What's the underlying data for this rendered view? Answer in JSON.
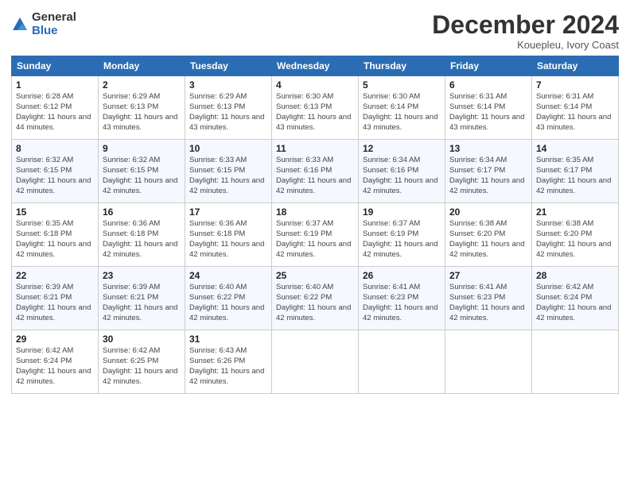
{
  "logo": {
    "general": "General",
    "blue": "Blue"
  },
  "header": {
    "month": "December 2024",
    "location": "Kouepleu, Ivory Coast"
  },
  "weekdays": [
    "Sunday",
    "Monday",
    "Tuesday",
    "Wednesday",
    "Thursday",
    "Friday",
    "Saturday"
  ],
  "weeks": [
    [
      {
        "day": "1",
        "sunrise": "6:28 AM",
        "sunset": "6:12 PM",
        "daylight": "11 hours and 44 minutes."
      },
      {
        "day": "2",
        "sunrise": "6:29 AM",
        "sunset": "6:13 PM",
        "daylight": "11 hours and 43 minutes."
      },
      {
        "day": "3",
        "sunrise": "6:29 AM",
        "sunset": "6:13 PM",
        "daylight": "11 hours and 43 minutes."
      },
      {
        "day": "4",
        "sunrise": "6:30 AM",
        "sunset": "6:13 PM",
        "daylight": "11 hours and 43 minutes."
      },
      {
        "day": "5",
        "sunrise": "6:30 AM",
        "sunset": "6:14 PM",
        "daylight": "11 hours and 43 minutes."
      },
      {
        "day": "6",
        "sunrise": "6:31 AM",
        "sunset": "6:14 PM",
        "daylight": "11 hours and 43 minutes."
      },
      {
        "day": "7",
        "sunrise": "6:31 AM",
        "sunset": "6:14 PM",
        "daylight": "11 hours and 43 minutes."
      }
    ],
    [
      {
        "day": "8",
        "sunrise": "6:32 AM",
        "sunset": "6:15 PM",
        "daylight": "11 hours and 42 minutes."
      },
      {
        "day": "9",
        "sunrise": "6:32 AM",
        "sunset": "6:15 PM",
        "daylight": "11 hours and 42 minutes."
      },
      {
        "day": "10",
        "sunrise": "6:33 AM",
        "sunset": "6:15 PM",
        "daylight": "11 hours and 42 minutes."
      },
      {
        "day": "11",
        "sunrise": "6:33 AM",
        "sunset": "6:16 PM",
        "daylight": "11 hours and 42 minutes."
      },
      {
        "day": "12",
        "sunrise": "6:34 AM",
        "sunset": "6:16 PM",
        "daylight": "11 hours and 42 minutes."
      },
      {
        "day": "13",
        "sunrise": "6:34 AM",
        "sunset": "6:17 PM",
        "daylight": "11 hours and 42 minutes."
      },
      {
        "day": "14",
        "sunrise": "6:35 AM",
        "sunset": "6:17 PM",
        "daylight": "11 hours and 42 minutes."
      }
    ],
    [
      {
        "day": "15",
        "sunrise": "6:35 AM",
        "sunset": "6:18 PM",
        "daylight": "11 hours and 42 minutes."
      },
      {
        "day": "16",
        "sunrise": "6:36 AM",
        "sunset": "6:18 PM",
        "daylight": "11 hours and 42 minutes."
      },
      {
        "day": "17",
        "sunrise": "6:36 AM",
        "sunset": "6:18 PM",
        "daylight": "11 hours and 42 minutes."
      },
      {
        "day": "18",
        "sunrise": "6:37 AM",
        "sunset": "6:19 PM",
        "daylight": "11 hours and 42 minutes."
      },
      {
        "day": "19",
        "sunrise": "6:37 AM",
        "sunset": "6:19 PM",
        "daylight": "11 hours and 42 minutes."
      },
      {
        "day": "20",
        "sunrise": "6:38 AM",
        "sunset": "6:20 PM",
        "daylight": "11 hours and 42 minutes."
      },
      {
        "day": "21",
        "sunrise": "6:38 AM",
        "sunset": "6:20 PM",
        "daylight": "11 hours and 42 minutes."
      }
    ],
    [
      {
        "day": "22",
        "sunrise": "6:39 AM",
        "sunset": "6:21 PM",
        "daylight": "11 hours and 42 minutes."
      },
      {
        "day": "23",
        "sunrise": "6:39 AM",
        "sunset": "6:21 PM",
        "daylight": "11 hours and 42 minutes."
      },
      {
        "day": "24",
        "sunrise": "6:40 AM",
        "sunset": "6:22 PM",
        "daylight": "11 hours and 42 minutes."
      },
      {
        "day": "25",
        "sunrise": "6:40 AM",
        "sunset": "6:22 PM",
        "daylight": "11 hours and 42 minutes."
      },
      {
        "day": "26",
        "sunrise": "6:41 AM",
        "sunset": "6:23 PM",
        "daylight": "11 hours and 42 minutes."
      },
      {
        "day": "27",
        "sunrise": "6:41 AM",
        "sunset": "6:23 PM",
        "daylight": "11 hours and 42 minutes."
      },
      {
        "day": "28",
        "sunrise": "6:42 AM",
        "sunset": "6:24 PM",
        "daylight": "11 hours and 42 minutes."
      }
    ],
    [
      {
        "day": "29",
        "sunrise": "6:42 AM",
        "sunset": "6:24 PM",
        "daylight": "11 hours and 42 minutes."
      },
      {
        "day": "30",
        "sunrise": "6:42 AM",
        "sunset": "6:25 PM",
        "daylight": "11 hours and 42 minutes."
      },
      {
        "day": "31",
        "sunrise": "6:43 AM",
        "sunset": "6:26 PM",
        "daylight": "11 hours and 42 minutes."
      },
      null,
      null,
      null,
      null
    ]
  ]
}
